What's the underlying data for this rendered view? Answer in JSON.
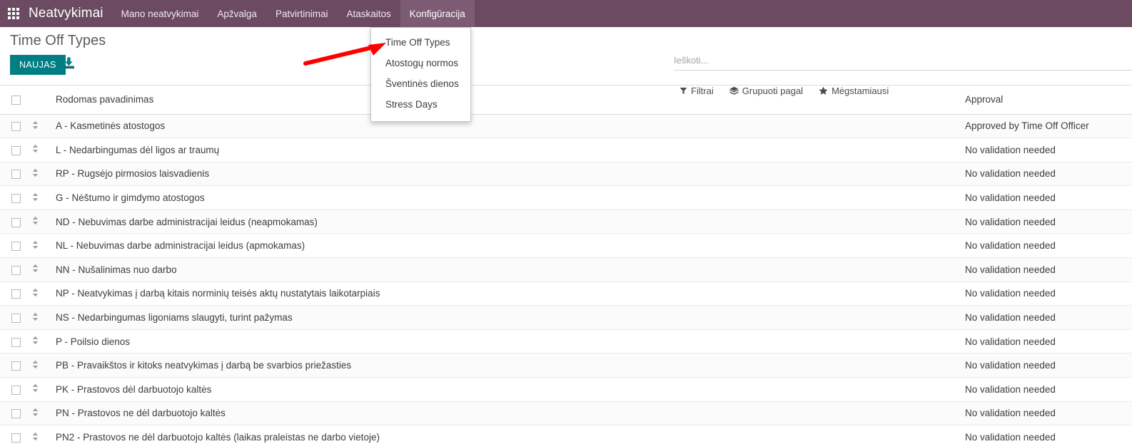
{
  "navbar": {
    "apps_icon": "apps-grid-icon",
    "brand": "Neatvykimai",
    "items": [
      {
        "label": "Mano neatvykimai",
        "active": false
      },
      {
        "label": "Apžvalga",
        "active": false
      },
      {
        "label": "Patvirtinimai",
        "active": false
      },
      {
        "label": "Ataskaitos",
        "active": false
      },
      {
        "label": "Konfigūracija",
        "active": true
      }
    ],
    "bg_color": "#6b4a62",
    "active_bg_color": "#7d5b75"
  },
  "dropdown": {
    "open": true,
    "items": [
      "Time Off Types",
      "Atostogų normos",
      "Šventinės dienos",
      "Stress Days"
    ]
  },
  "annotation": {
    "type": "red-arrow",
    "color": "#ff0000",
    "points_to": "Time Off Types"
  },
  "control_panel": {
    "title": "Time Off Types",
    "new_button": "NAUJAS",
    "new_button_color": "#017e84",
    "import_icon": "import-download-icon"
  },
  "search": {
    "placeholder": "Ieškoti...",
    "value": ""
  },
  "filters": [
    {
      "label": "Filtrai",
      "icon": "funnel-icon"
    },
    {
      "label": "Grupuoti pagal",
      "icon": "layers-icon"
    },
    {
      "label": "Mėgstamiausi",
      "icon": "star-icon"
    }
  ],
  "table": {
    "headers": {
      "name": "Rodomas pavadinimas",
      "approval": "Approval"
    },
    "rows": [
      {
        "name": "A - Kasmetinės atostogos",
        "approval": "Approved by Time Off Officer"
      },
      {
        "name": "L - Nedarbingumas dėl ligos ar traumų",
        "approval": "No validation needed"
      },
      {
        "name": "RP - Rugsėjo pirmosios laisvadienis",
        "approval": "No validation needed"
      },
      {
        "name": "G - Nėštumo ir gimdymo atostogos",
        "approval": "No validation needed"
      },
      {
        "name": "ND - Nebuvimas darbe administracijai leidus (neapmokamas)",
        "approval": "No validation needed"
      },
      {
        "name": "NL - Nebuvimas darbe administracijai leidus (apmokamas)",
        "approval": "No validation needed"
      },
      {
        "name": "NN - Nušalinimas nuo darbo",
        "approval": "No validation needed"
      },
      {
        "name": "NP - Neatvykimas į darbą kitais norminių teisės aktų nustatytais laikotarpiais",
        "approval": "No validation needed"
      },
      {
        "name": "NS - Nedarbingumas ligoniams slaugyti, turint pažymas",
        "approval": "No validation needed"
      },
      {
        "name": "P - Poilsio dienos",
        "approval": "No validation needed"
      },
      {
        "name": "PB - Pravaikštos ir kitoks neatvykimas į darbą be svarbios priežasties",
        "approval": "No validation needed"
      },
      {
        "name": "PK - Prastovos dėl darbuotojo kaltės",
        "approval": "No validation needed"
      },
      {
        "name": "PN - Prastovos ne dėl darbuotojo kaltės",
        "approval": "No validation needed"
      },
      {
        "name": "PN2 - Prastovos ne dėl darbuotojo kaltės (laikas praleistas ne darbo vietoje)",
        "approval": "No validation needed"
      }
    ]
  }
}
